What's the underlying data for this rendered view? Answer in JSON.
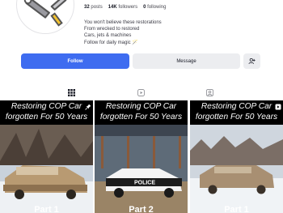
{
  "profile": {
    "avatar_icon": "wrench-screwdriver-logo-icon",
    "stats": [
      {
        "value": "32",
        "label": "posts"
      },
      {
        "value": "14K",
        "label": "followers"
      },
      {
        "value": "0",
        "label": "following"
      }
    ],
    "bio": [
      "You won't believe these restorations",
      "From wrecked to restored",
      "Cars, jets & machines",
      "Follow for daily magic 🪄"
    ]
  },
  "actions": {
    "follow_label": "Follow",
    "message_label": "Message",
    "add_user_icon": "add-user-icon"
  },
  "tabs": [
    {
      "icon": "grid-icon",
      "active": true
    },
    {
      "icon": "reels-icon",
      "active": false
    },
    {
      "icon": "tagged-icon",
      "active": false
    }
  ],
  "posts": [
    {
      "caption_line1": "Restoring COP Car",
      "caption_line2": "forgotten For 50 Years",
      "part": "Part 1",
      "badge": "pin-icon"
    },
    {
      "caption_line1": "Restoring COP Car",
      "caption_line2": "forgotten For 50 Years",
      "part": "Part 2",
      "badge": ""
    },
    {
      "caption_line1": "Restoring COP Car",
      "caption_line2": "forgotten For 50 Years",
      "part": "Part 1",
      "badge": "reel-icon"
    }
  ],
  "colors": {
    "accent": "#3e6cf0",
    "secondary_button": "#ecedf0"
  }
}
